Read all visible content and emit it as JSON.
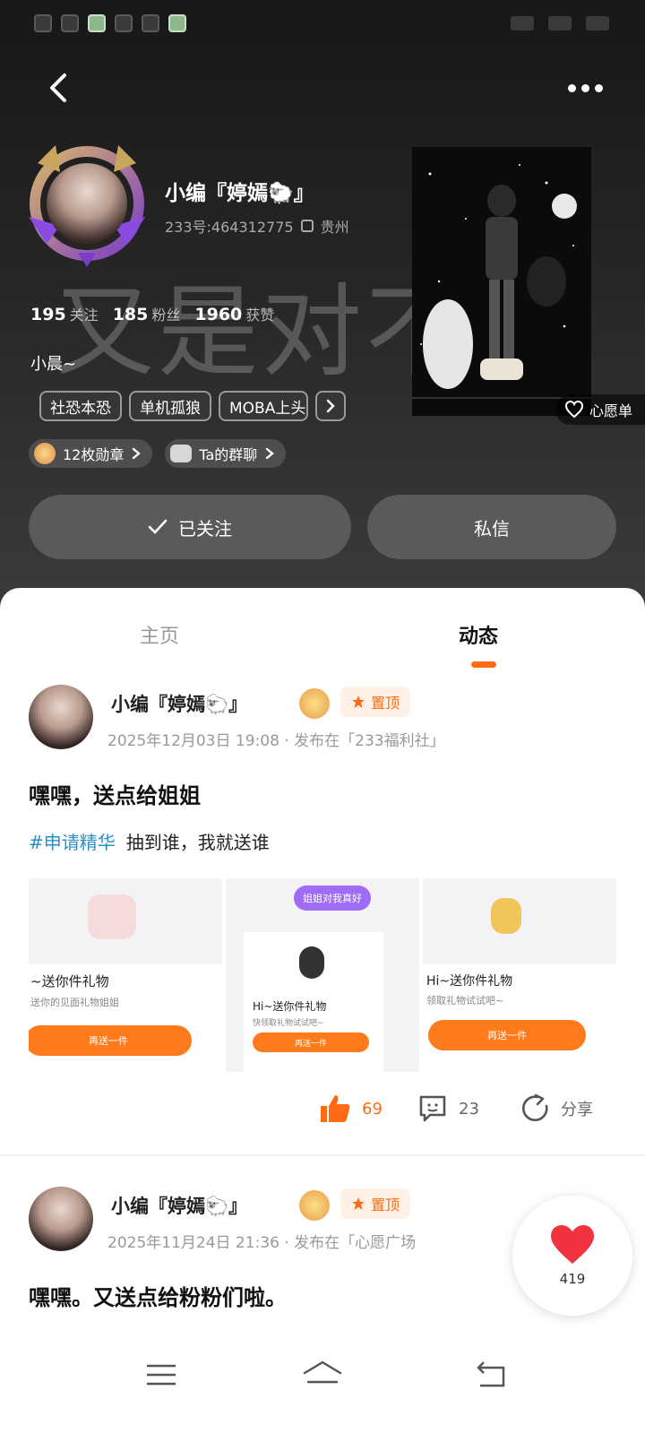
{
  "header": {
    "nickname": "小编『婷嫣🐑』",
    "uid": "233号:464312775",
    "location": "贵州",
    "stats": [
      {
        "value": "195",
        "label": "关注"
      },
      {
        "value": "185",
        "label": "粉丝"
      },
      {
        "value": "1960",
        "label": "获赞"
      }
    ],
    "watermark": "又是对不",
    "bio": "小晨~",
    "tags": [
      "社恐本恐",
      "单机孤狼",
      "MOBA上头"
    ],
    "medals": "12枚勋章",
    "group_chat": "Ta的群聊",
    "wishlist": "心愿单",
    "follow_label": "已关注",
    "message_label": "私信"
  },
  "tabs": {
    "home": "主页",
    "feed": "动态"
  },
  "posts": [
    {
      "author": "小编『婷嫣🐑』",
      "pin": "置顶",
      "meta": "2025年12月03日 19:08 · 发布在「233福利社」",
      "title": "嘿嘿，送点给姐姐",
      "hashtag": "#申请精华",
      "body": "抽到谁，我就送谁",
      "images": [
        {
          "heading": "~送你件礼物",
          "sub": "送你的见面礼物姐姐",
          "cta": "再送一件"
        },
        {
          "bubble": "姐姐对我真好",
          "heading": "Hi~送你件礼物",
          "sub": "快领取礼物试试吧~",
          "cta": "再送一件"
        },
        {
          "heading": "Hi~送你件礼物",
          "sub": "领取礼物试试吧~",
          "cta": "再送一件"
        }
      ],
      "likes": "69",
      "comments": "23",
      "share_label": "分享"
    },
    {
      "author": "小编『婷嫣🐑』",
      "pin": "置顶",
      "meta": "2025年11月24日 21:36 · 发布在「心愿广场",
      "title": "嘿嘿。又送点给粉粉们啦。"
    }
  ],
  "fab": {
    "count": "419"
  },
  "colors": {
    "accent": "#ff6a13",
    "hashtag": "#2a8fc9",
    "header_bg": "#262626"
  },
  "icons": [
    "back-icon",
    "more-icon",
    "copy-icon",
    "check-icon",
    "heart-icon",
    "pin-icon",
    "thumbs-up-icon",
    "comment-icon",
    "share-icon",
    "menu-icon",
    "home-icon",
    "return-icon"
  ]
}
